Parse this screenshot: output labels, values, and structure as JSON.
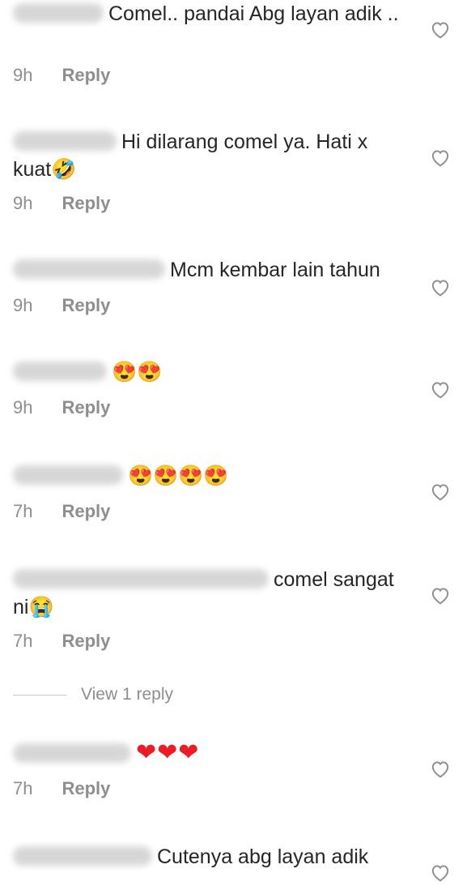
{
  "comments": [
    {
      "text": "Comel.. pandai Abg layan adik ..",
      "time": "9h",
      "reply_label": "Reply"
    },
    {
      "text": "Hi dilarang comel ya. Hati x kuat",
      "emoji": "🤣",
      "time": "9h",
      "reply_label": "Reply"
    },
    {
      "text": "Mcm kembar lain tahun",
      "time": "9h",
      "reply_label": "Reply"
    },
    {
      "text": "",
      "emoji": "😍😍",
      "time": "9h",
      "reply_label": "Reply"
    },
    {
      "text": "",
      "emoji": "😍😍😍😍",
      "time": "7h",
      "reply_label": "Reply"
    },
    {
      "text": "comel sangat ni",
      "emoji": "😭",
      "time": "7h",
      "reply_label": "Reply"
    },
    {
      "text": "",
      "emoji": "❤❤❤",
      "time": "7h",
      "reply_label": "Reply"
    },
    {
      "text": "Cutenya abg layan adik",
      "time": "",
      "reply_label": ""
    }
  ],
  "view_replies_label": "View 1 reply",
  "icons": {
    "like": "heart-outline-icon"
  },
  "colors": {
    "text": "#262626",
    "meta": "#8e8e8e",
    "heart_emoji": "#ed1c24"
  }
}
